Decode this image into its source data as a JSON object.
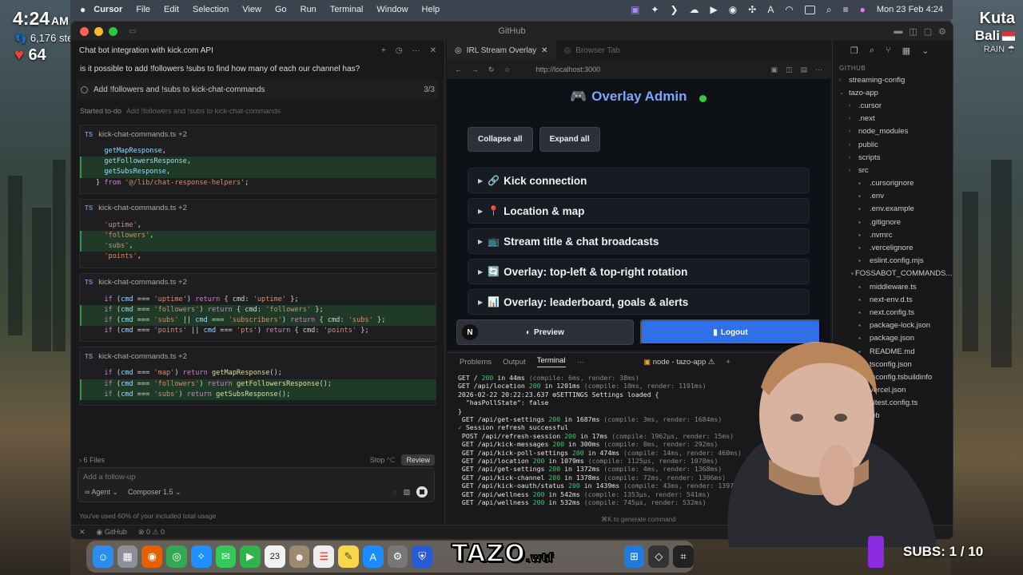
{
  "overlay": {
    "time": "4:24",
    "ampm": "AM",
    "steps": "6,176 steps",
    "heart_rate": "64",
    "city": "Kuta",
    "region": "Bali",
    "weather": "RAIN",
    "brand": "TAZO",
    "brand_suffix": ".wtf",
    "subs": "SUBS: 1 / 10"
  },
  "menubar": {
    "app": "Cursor",
    "items": [
      "File",
      "Edit",
      "Selection",
      "View",
      "Go",
      "Run",
      "Terminal",
      "Window",
      "Help"
    ],
    "datetime": "Mon 23 Feb  4:24"
  },
  "window": {
    "title": "GitHub"
  },
  "chat": {
    "title": "Chat bot integration with kick.com API",
    "question": "is it possible to add !followers !subs to find how many of each our channel has?",
    "todo": "Add !followers and !subs to kick-chat-commands",
    "todo_count": "3/3",
    "started_label": "Started to-do",
    "started_task": "Add !followers and !subs to kick-chat-commands",
    "files_count": "6 Files",
    "stop": "Stop",
    "stop_shortcut": "^C",
    "review": "Review",
    "placeholder": "Add a follow-up",
    "mode": "Agent",
    "model": "Composer 1.5",
    "usage": "You've used 60% of your included total usage",
    "diff_file": "kick-chat-commands.ts",
    "diff_more": "+2",
    "file_tag": "TS"
  },
  "browser": {
    "tab_active": "IRL Stream Overlay",
    "tab_inactive": "Browser Tab",
    "url": "http://localhost:3000",
    "page_title": "Overlay Admin",
    "collapse": "Collapse all",
    "expand": "Expand all",
    "sections": [
      {
        "icon": "🔗",
        "label": "Kick connection"
      },
      {
        "icon": "📍",
        "label": "Location & map"
      },
      {
        "icon": "📺",
        "label": "Stream title & chat broadcasts"
      },
      {
        "icon": "🔄",
        "label": "Overlay: top-left & top-right rotation"
      },
      {
        "icon": "📊",
        "label": "Overlay: leaderboard, goals & alerts"
      }
    ],
    "preview": "Preview",
    "logout": "Logout",
    "n_badge": "N"
  },
  "terminal": {
    "tabs": [
      "Problems",
      "Output",
      "Terminal"
    ],
    "active_tab": "Terminal",
    "node_label": "node - tazo-app",
    "hint": "⌘K to generate command"
  },
  "explorer": {
    "section": "GITHUB",
    "items": [
      {
        "label": "streaming-config",
        "type": "folder",
        "depth": 0
      },
      {
        "label": "tazo-app",
        "type": "folder-open",
        "depth": 0
      },
      {
        "label": ".cursor",
        "type": "folder",
        "depth": 1
      },
      {
        "label": ".next",
        "type": "folder",
        "depth": 1
      },
      {
        "label": "node_modules",
        "type": "folder",
        "depth": 1
      },
      {
        "label": "public",
        "type": "folder",
        "depth": 1
      },
      {
        "label": "scripts",
        "type": "folder",
        "depth": 1
      },
      {
        "label": "src",
        "type": "folder",
        "depth": 1
      },
      {
        "label": ".cursorignore",
        "type": "file",
        "depth": 1
      },
      {
        "label": ".env",
        "type": "file",
        "depth": 1
      },
      {
        "label": ".env.example",
        "type": "file",
        "depth": 1
      },
      {
        "label": ".gitignore",
        "type": "file",
        "depth": 1
      },
      {
        "label": ".nvmrc",
        "type": "file",
        "depth": 1
      },
      {
        "label": ".vercelignore",
        "type": "file",
        "depth": 1
      },
      {
        "label": "eslint.config.mjs",
        "type": "file",
        "depth": 1
      },
      {
        "label": "FOSSABOT_COMMANDS....",
        "type": "file",
        "depth": 1
      },
      {
        "label": "middleware.ts",
        "type": "file",
        "depth": 1
      },
      {
        "label": "next-env.d.ts",
        "type": "file",
        "depth": 1
      },
      {
        "label": "next.config.ts",
        "type": "file",
        "depth": 1
      },
      {
        "label": "package-lock.json",
        "type": "file",
        "depth": 1
      },
      {
        "label": "package.json",
        "type": "file",
        "depth": 1
      },
      {
        "label": "README.md",
        "type": "file",
        "depth": 1
      },
      {
        "label": "tsconfig.json",
        "type": "file",
        "depth": 1
      },
      {
        "label": "tsconfig.tsbuildinfo",
        "type": "file",
        "depth": 1
      },
      {
        "label": "vercel.json",
        "type": "file",
        "depth": 1
      },
      {
        "label": "vitest.config.ts",
        "type": "file",
        "depth": 1
      },
      {
        "label": "tazo-web",
        "type": "folder",
        "depth": 0
      }
    ]
  },
  "statusbar": {
    "branch": "GitHub",
    "problems": "⊗ 0 ⚠ 0"
  }
}
